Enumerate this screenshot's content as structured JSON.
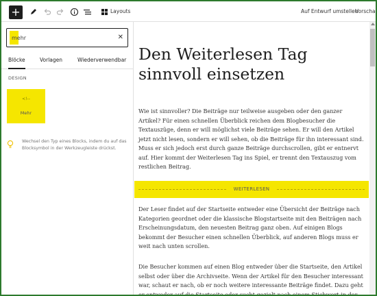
{
  "toolbar": {
    "add_icon": "plus-icon",
    "tools_icon": "pencil-icon",
    "undo_icon": "undo-icon",
    "redo_icon": "redo-icon",
    "details_icon": "info-icon",
    "outline_icon": "list-view-icon",
    "layouts_label": "Layouts",
    "draft_label": "Auf Entwurf umstellen",
    "preview_label": "Vorschau",
    "publish_label": "A"
  },
  "sidebar": {
    "search": {
      "value": "mehr",
      "placeholder": "Suche"
    },
    "tabs": [
      {
        "label": "Blöcke",
        "active": true
      },
      {
        "label": "Vorlagen",
        "active": false
      },
      {
        "label": "Wiederverwendbar",
        "active": false
      }
    ],
    "section_title": "DESIGN",
    "block": {
      "icon_label": "<!--",
      "label": "Mehr"
    },
    "tip_text": "Wechsel den Typ eines Blocks, indem du auf das Blocksymbol in der Werkzeugleiste drückst."
  },
  "post": {
    "title": "Den Weiterlesen Tag sinnvoll einsetzen",
    "intro": "Wie ist sinnvoller? Die Beiträge nur teilweise ausgeben oder den ganzer Artikel? Für einen schnellen Überblick reichen dem Blogbesucher die Textauszüge, denn er will möglichst viele Beiträge sehen. Er will den Artikel jetzt nicht lesen, sondern er will sehen, ob die Beiträge für ihn interessant sind. Muss er sich jedoch erst durch ganze Beiträge durchscrollen, gibt er entnervt auf. Hier kommt der Weiterlesen Tag ins Spiel, er trennt den Textauszug vom restlichen Beitrag.",
    "more_label": "WEITERLESEN",
    "para2": "Der Leser findet auf der Startseite entweder eine Übersicht der Beiträge nach Kategorien geordnet oder die klassische Blogstartseite mit den Beiträgen nach Erscheinungsdatum, den neuesten Beitrag ganz oben. Auf einigen Blogs bekommt der Besucher einen schnellen Überblick, auf anderen Blogs muss er weit nach unten scrollen.",
    "para3": "Die Besucher kommen auf einen Blog entweder über die Startseite, den Artikel selbst oder über die Archivseite. Wenn der Artikel für den Besucher interessant war, schaut er nach, ob er noch weitere interessante Beiträge findet. Dazu geht er entweder auf die Startseite oder sucht gezielt nach einem Stichwort in der"
  },
  "colors": {
    "highlight": "#f5e600",
    "frame": "#2d7a2d",
    "dark": "#1e1e1e"
  }
}
